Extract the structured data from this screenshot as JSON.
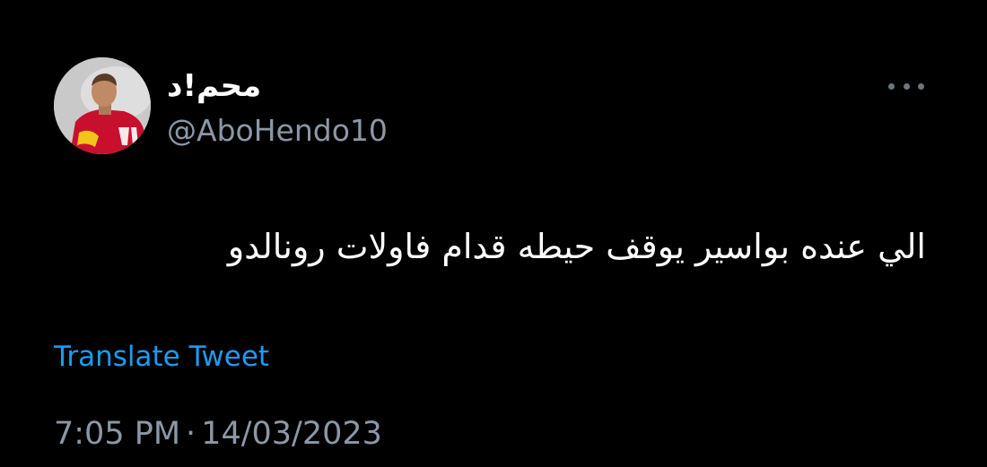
{
  "tweet": {
    "author": {
      "display_name": "محم!د",
      "handle": "@AboHendo10",
      "avatar": "avatar-photo-player-red-jersey"
    },
    "more_icon": "more-horizontal-icon",
    "text": "الي عنده بواسير يوقف حيطه قدام فاولات رونالدو",
    "translate_label": "Translate Tweet",
    "time": "7:05 PM",
    "separator": "·",
    "date": "14/03/2023"
  },
  "colors": {
    "background": "#000000",
    "text_primary": "#ffffff",
    "text_secondary": "#8b98a5",
    "link": "#1d9bf0"
  }
}
